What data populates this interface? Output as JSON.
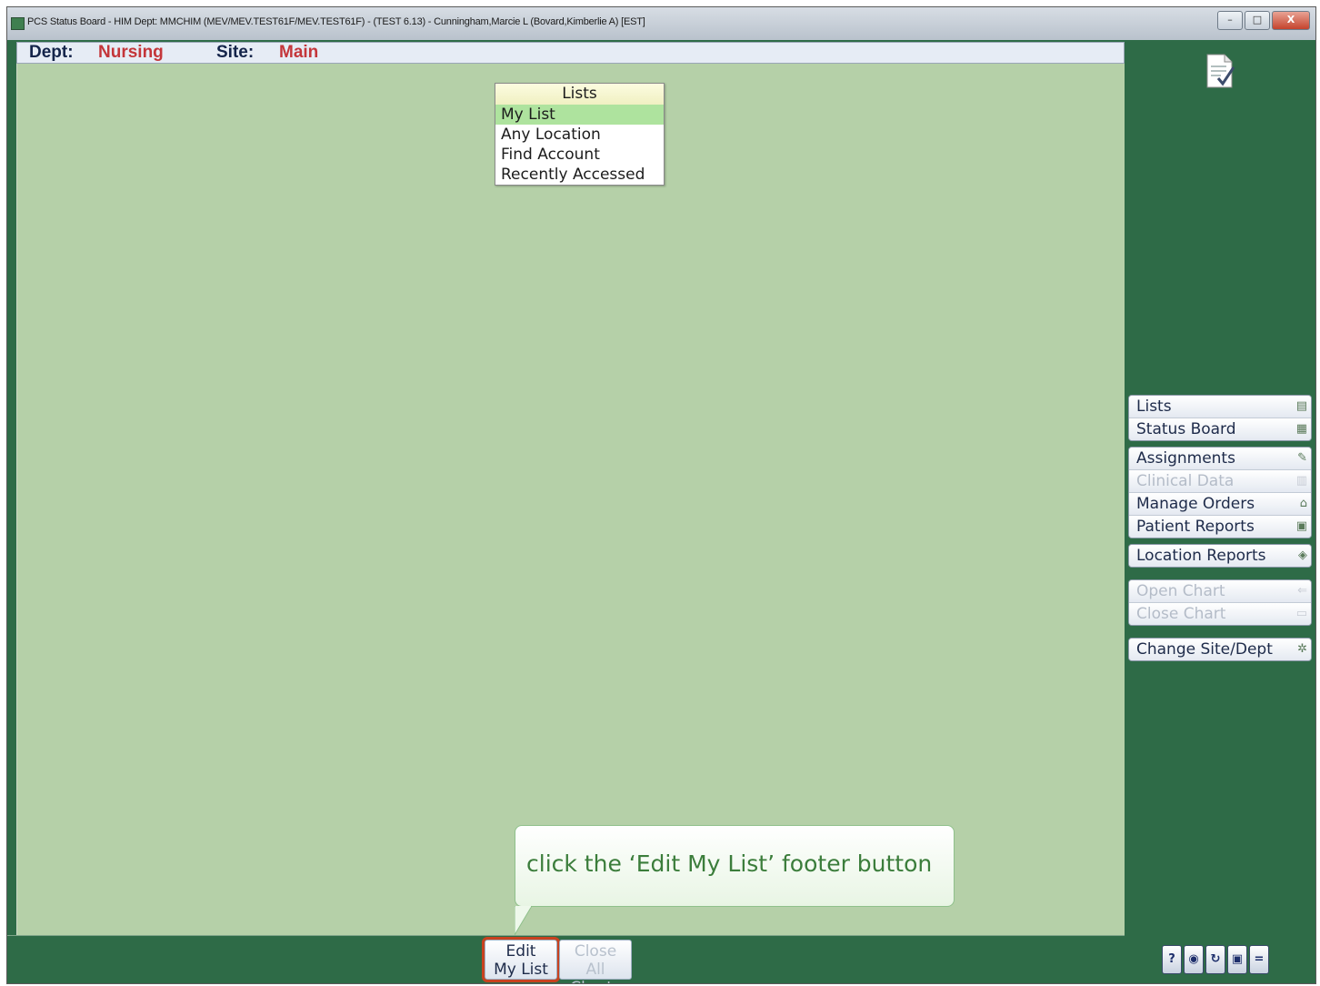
{
  "window": {
    "title": "PCS Status Board - HIM Dept: MMCHIM (MEV/MEV.TEST61F/MEV.TEST61F) - (TEST 6.13) - Cunningham,Marcie L (Bovard,Kimberlie A) [EST]",
    "minimize": "–",
    "maximize": "□",
    "close": "X"
  },
  "info": {
    "dept_label": "Dept:",
    "dept_value": "Nursing",
    "site_label": "Site:",
    "site_value": "Main"
  },
  "lists_menu": {
    "header": "Lists",
    "items": [
      "My List",
      "Any Location",
      "Find Account",
      "Recently Accessed"
    ],
    "selected_index": 0
  },
  "callout": {
    "text": "click the ‘Edit My List’ footer button"
  },
  "nav": {
    "group1": [
      {
        "label": "Lists",
        "icon": "list-check-icon",
        "glyph": "▤",
        "enabled": true
      },
      {
        "label": "Status Board",
        "icon": "grid-icon",
        "glyph": "▦",
        "enabled": true
      }
    ],
    "group2": [
      {
        "label": "Assignments",
        "icon": "pencil-icon",
        "glyph": "✎",
        "enabled": true
      },
      {
        "label": "Clinical Data",
        "icon": "chart-icon",
        "glyph": "▥",
        "enabled": false
      },
      {
        "label": "Manage Orders",
        "icon": "orders-icon",
        "glyph": "⌂",
        "enabled": true
      },
      {
        "label": "Patient Reports",
        "icon": "report-icon",
        "glyph": "▣",
        "enabled": true
      }
    ],
    "group3": [
      {
        "label": "Location Reports",
        "icon": "location-report-icon",
        "glyph": "◈",
        "enabled": true
      }
    ],
    "group4": [
      {
        "label": "Open Chart",
        "icon": "open-chart-icon",
        "glyph": "⇐",
        "enabled": false
      },
      {
        "label": "Close Chart",
        "icon": "close-chart-icon",
        "glyph": "▭",
        "enabled": false
      }
    ],
    "group5": [
      {
        "label": "Change Site/Dept",
        "icon": "gear-icon",
        "glyph": "✲",
        "enabled": true
      }
    ]
  },
  "footer": {
    "edit_line1": "Edit",
    "edit_line2": "My List",
    "close_line1": "Close",
    "close_line2": "All Charts"
  },
  "tray": [
    {
      "icon": "help-icon",
      "glyph": "?"
    },
    {
      "icon": "globe-icon",
      "glyph": "◉"
    },
    {
      "icon": "refresh-icon",
      "glyph": "↻"
    },
    {
      "icon": "lock-icon",
      "glyph": "▣"
    },
    {
      "icon": "minimize-panel-icon",
      "glyph": "="
    }
  ],
  "colors": {
    "background_green": "#2e6b47",
    "content_green": "#b5d0a8",
    "value_red": "#c4363a",
    "highlight_red": "#c8421f",
    "selected_item": "#aee39e"
  }
}
